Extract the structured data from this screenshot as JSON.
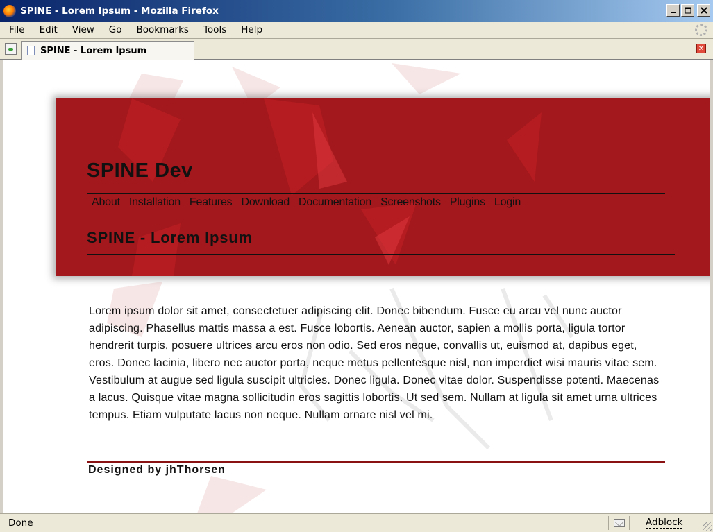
{
  "window": {
    "title": "SPINE - Lorem Ipsum - Mozilla Firefox",
    "app_icon": "firefox-icon",
    "controls": [
      "minimize-icon",
      "maximize-icon",
      "close-icon"
    ]
  },
  "menubar": {
    "items": [
      "File",
      "Edit",
      "View",
      "Go",
      "Bookmarks",
      "Tools",
      "Help"
    ]
  },
  "tabbar": {
    "tabs": [
      {
        "label": "SPINE - Lorem Ipsum",
        "icon": "document-icon"
      }
    ]
  },
  "page": {
    "site_title": "SPINE Dev",
    "nav": [
      "About",
      "Installation",
      "Features",
      "Download",
      "Documentation",
      "Screenshots",
      "Plugins",
      "Login"
    ],
    "heading": "SPINE - Lorem Ipsum",
    "body_text": "Lorem ipsum dolor sit amet, consectetuer adipiscing elit. Donec bibendum. Fusce eu arcu vel nunc auctor adipiscing. Phasellus mattis massa a est. Fusce lobortis. Aenean auctor, sapien a mollis porta, ligula tortor hendrerit turpis, posuere ultrices arcu eros non odio. Sed eros neque, convallis ut, euismod at, dapibus eget, eros. Donec lacinia, libero nec auctor porta, neque metus pellentesque nisl, non imperdiet wisi mauris vitae sem. Vestibulum at augue sed ligula suscipit ultricies. Donec ligula. Donec vitae dolor. Suspendisse potenti. Maecenas a lacus. Quisque vitae magna sollicitudin eros sagittis lobortis. Ut sed sem. Nullam at ligula sit amet urna ultrices tempus. Etiam vulputate lacus non neque. Nullam ornare nisl vel mi.",
    "footer": "Designed by jhThorsen",
    "colors": {
      "banner": "#a3181c",
      "footer_rule": "#8b1212",
      "text": "#111111"
    }
  },
  "statusbar": {
    "status": "Done",
    "mail_icon": "mail-icon",
    "adblock": "Adblock"
  }
}
